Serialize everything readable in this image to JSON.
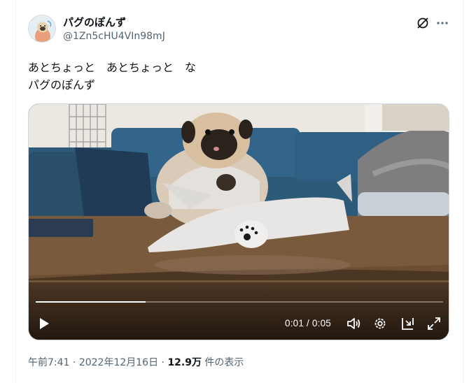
{
  "user": {
    "display_name": "パグのぽんず",
    "handle": "@1Zn5cHU4VIn98mJ"
  },
  "tweet": {
    "line1": "あとちょっと　あとちょっと　な",
    "line2": "パグのぽんず"
  },
  "video": {
    "time": "0:01 / 0:05",
    "progress": 0.27
  },
  "meta": {
    "time": "午前7:41",
    "sep1": " · ",
    "date": "2022年12月16日",
    "sep2": " · ",
    "views_count": "12.9万",
    "views_label": " 件の表示"
  },
  "icons": {
    "grok": "grok-icon",
    "more": "more-icon",
    "play": "play-icon",
    "volume": "volume-icon",
    "settings": "gear-icon",
    "dock": "dock-icon",
    "fullscreen": "fullscreen-icon"
  },
  "colors": {
    "text": "#0f1419",
    "secondary": "#536471",
    "border": "#cfd9de"
  }
}
